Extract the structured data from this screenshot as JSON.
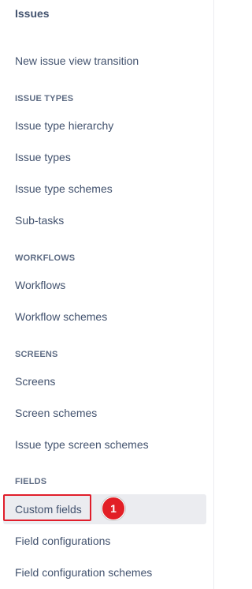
{
  "sidebar": {
    "title": "Issues",
    "top_item": "New issue view transition",
    "sections": {
      "issue_types": {
        "header": "ISSUE TYPES",
        "items": [
          "Issue type hierarchy",
          "Issue types",
          "Issue type schemes",
          "Sub-tasks"
        ]
      },
      "workflows": {
        "header": "WORKFLOWS",
        "items": [
          "Workflows",
          "Workflow schemes"
        ]
      },
      "screens": {
        "header": "SCREENS",
        "items": [
          "Screens",
          "Screen schemes",
          "Issue type screen schemes"
        ]
      },
      "fields": {
        "header": "FIELDS",
        "items": [
          "Custom fields",
          "Field configurations",
          "Field configuration schemes"
        ]
      }
    }
  },
  "annotation": {
    "badge_number": "1"
  },
  "colors": {
    "highlight": "#e01e2b",
    "badge": "#e21f26",
    "selected_background": "#ebecf0",
    "text": "#42526e",
    "section_header": "#5e6c84"
  }
}
